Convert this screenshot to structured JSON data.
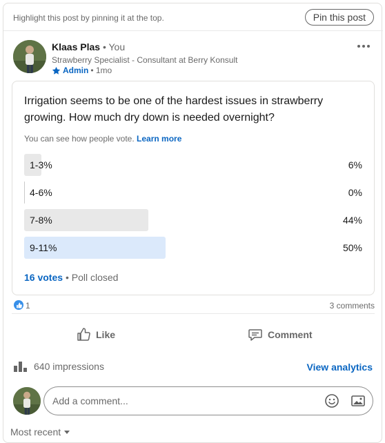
{
  "pin_bar": {
    "hint": "Highlight this post by pinning it at the top.",
    "pin_button": "Pin this post"
  },
  "author": {
    "name": "Klaas Plas",
    "relation": "• You",
    "headline": "Strawberry Specialist - Consultant at Berry Konsult",
    "role": "Admin",
    "time": "• 1mo",
    "avatar_icon": "profile-photo"
  },
  "poll": {
    "question": "Irrigation seems to be one of the hardest issues in strawberry growing. How much dry down is needed overnight?",
    "note": "You can see how people vote.",
    "learn_more": "Learn more",
    "options": [
      {
        "label": "1-3%",
        "percent_text": "6%",
        "percent": 6,
        "selected": false
      },
      {
        "label": "4-6%",
        "percent_text": "0%",
        "percent": 0,
        "selected": false
      },
      {
        "label": "7-8%",
        "percent_text": "44%",
        "percent": 44,
        "selected": false
      },
      {
        "label": "9-11%",
        "percent_text": "50%",
        "percent": 50,
        "selected": true
      }
    ],
    "votes": "16 votes",
    "status": "• Poll closed"
  },
  "social": {
    "reaction_icon": "like-reaction-icon",
    "reaction_count": "1",
    "comments_count": "3 comments"
  },
  "actions": {
    "like": "Like",
    "comment": "Comment"
  },
  "analytics": {
    "impressions": "640 impressions",
    "view_analytics": "View analytics"
  },
  "comment_box": {
    "placeholder": "Add a comment..."
  },
  "sort": {
    "label": "Most recent"
  },
  "colors": {
    "accent": "#0a66c2",
    "bar_default": "#e8e8e8",
    "bar_selected": "#dbe9fb"
  }
}
